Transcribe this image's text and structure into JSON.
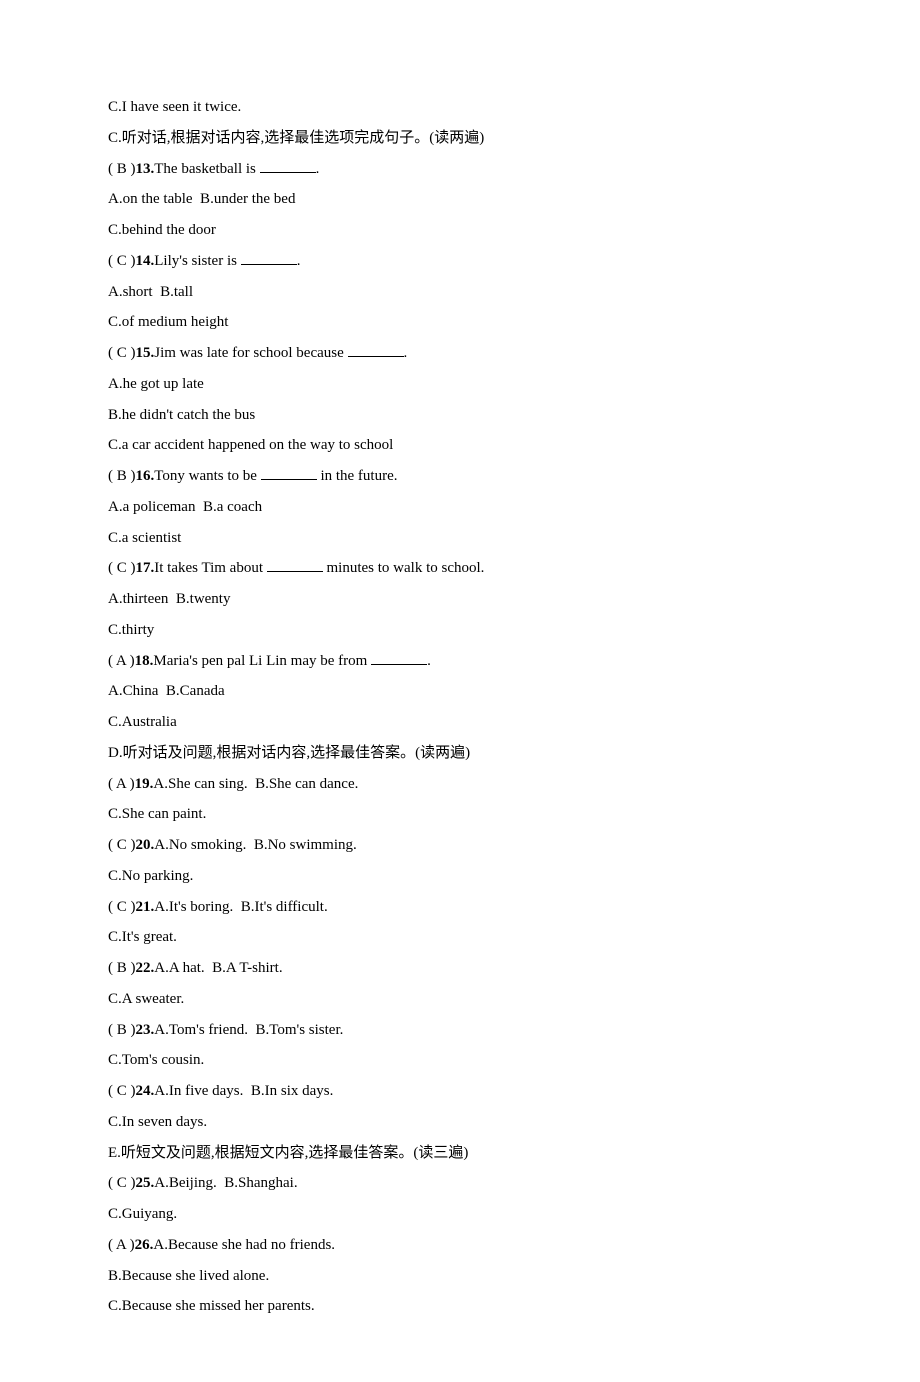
{
  "lines": [
    {
      "id": "l12c",
      "segments": [
        {
          "t": "C.I have seen it twice."
        }
      ]
    },
    {
      "id": "sectionC",
      "segments": [
        {
          "t": "C.听对话,根据对话内容,选择最佳选项完成句子。(读两遍)"
        }
      ]
    },
    {
      "id": "q13",
      "segments": [
        {
          "t": "( B )"
        },
        {
          "t": "13.",
          "bold": true
        },
        {
          "t": "The basketball is "
        },
        {
          "blank": true
        },
        {
          "t": "."
        }
      ]
    },
    {
      "id": "q13a",
      "segments": [
        {
          "t": "A.on the table  B.under the bed"
        }
      ]
    },
    {
      "id": "q13c",
      "segments": [
        {
          "t": "C.behind the door"
        }
      ]
    },
    {
      "id": "q14",
      "segments": [
        {
          "t": "( C )"
        },
        {
          "t": "14.",
          "bold": true
        },
        {
          "t": "Lily's sister is "
        },
        {
          "blank": true
        },
        {
          "t": "."
        }
      ]
    },
    {
      "id": "q14a",
      "segments": [
        {
          "t": "A.short  B.tall"
        }
      ]
    },
    {
      "id": "q14c",
      "segments": [
        {
          "t": "C.of medium height"
        }
      ]
    },
    {
      "id": "q15",
      "segments": [
        {
          "t": "( C )"
        },
        {
          "t": "15.",
          "bold": true
        },
        {
          "t": "Jim was late for school because "
        },
        {
          "blank": true
        },
        {
          "t": "."
        }
      ]
    },
    {
      "id": "q15a",
      "segments": [
        {
          "t": "A.he got up late"
        }
      ]
    },
    {
      "id": "q15b",
      "segments": [
        {
          "t": "B.he didn't catch the bus"
        }
      ]
    },
    {
      "id": "q15c",
      "segments": [
        {
          "t": "C.a car accident happened on the way to school"
        }
      ]
    },
    {
      "id": "q16",
      "segments": [
        {
          "t": "( B )"
        },
        {
          "t": "16.",
          "bold": true
        },
        {
          "t": "Tony wants to be "
        },
        {
          "blank": true
        },
        {
          "t": " in the future."
        }
      ]
    },
    {
      "id": "q16a",
      "segments": [
        {
          "t": "A.a policeman  B.a coach"
        }
      ]
    },
    {
      "id": "q16c",
      "segments": [
        {
          "t": "C.a scientist"
        }
      ]
    },
    {
      "id": "q17",
      "segments": [
        {
          "t": "( C )"
        },
        {
          "t": "17.",
          "bold": true
        },
        {
          "t": "It takes Tim about "
        },
        {
          "blank": true
        },
        {
          "t": " minutes to walk to school."
        }
      ]
    },
    {
      "id": "q17a",
      "segments": [
        {
          "t": "A.thirteen  B.twenty"
        }
      ]
    },
    {
      "id": "q17c",
      "segments": [
        {
          "t": "C.thirty"
        }
      ]
    },
    {
      "id": "q18",
      "segments": [
        {
          "t": "( A )"
        },
        {
          "t": "18.",
          "bold": true
        },
        {
          "t": "Maria's pen pal Li Lin may be from "
        },
        {
          "blank": true
        },
        {
          "t": "."
        }
      ]
    },
    {
      "id": "q18a",
      "segments": [
        {
          "t": "A.China  B.Canada"
        }
      ]
    },
    {
      "id": "q18c",
      "segments": [
        {
          "t": "C.Australia"
        }
      ]
    },
    {
      "id": "sectionD",
      "segments": [
        {
          "t": "D.听对话及问题,根据对话内容,选择最佳答案。(读两遍)"
        }
      ]
    },
    {
      "id": "q19",
      "segments": [
        {
          "t": "( A )"
        },
        {
          "t": "19.",
          "bold": true
        },
        {
          "t": "A.She can sing.  B.She can dance."
        }
      ]
    },
    {
      "id": "q19c",
      "segments": [
        {
          "t": "C.She can paint."
        }
      ]
    },
    {
      "id": "q20",
      "segments": [
        {
          "t": "( C )"
        },
        {
          "t": "20.",
          "bold": true
        },
        {
          "t": "A.No smoking.  B.No swimming."
        }
      ]
    },
    {
      "id": "q20c",
      "segments": [
        {
          "t": "C.No parking."
        }
      ]
    },
    {
      "id": "q21",
      "segments": [
        {
          "t": "( C )"
        },
        {
          "t": "21.",
          "bold": true
        },
        {
          "t": "A.It's boring.  B.It's difficult."
        }
      ]
    },
    {
      "id": "q21c",
      "segments": [
        {
          "t": "C.It's great."
        }
      ]
    },
    {
      "id": "q22",
      "segments": [
        {
          "t": "( B )"
        },
        {
          "t": "22.",
          "bold": true
        },
        {
          "t": "A.A hat.  B.A T-shirt."
        }
      ]
    },
    {
      "id": "q22c",
      "segments": [
        {
          "t": "C.A sweater."
        }
      ]
    },
    {
      "id": "q23",
      "segments": [
        {
          "t": "( B )"
        },
        {
          "t": "23.",
          "bold": true
        },
        {
          "t": "A.Tom's friend.  B.Tom's sister."
        }
      ]
    },
    {
      "id": "q23c",
      "segments": [
        {
          "t": "C.Tom's cousin."
        }
      ]
    },
    {
      "id": "q24",
      "segments": [
        {
          "t": "( C )"
        },
        {
          "t": "24.",
          "bold": true
        },
        {
          "t": "A.In five days.  B.In six days."
        }
      ]
    },
    {
      "id": "q24c",
      "segments": [
        {
          "t": "C.In seven days."
        }
      ]
    },
    {
      "id": "sectionE",
      "segments": [
        {
          "t": "E.听短文及问题,根据短文内容,选择最佳答案。(读三遍)"
        }
      ]
    },
    {
      "id": "q25",
      "segments": [
        {
          "t": "( C )"
        },
        {
          "t": "25.",
          "bold": true
        },
        {
          "t": "A.Beijing.  B.Shanghai."
        }
      ]
    },
    {
      "id": "q25c",
      "segments": [
        {
          "t": "C.Guiyang."
        }
      ]
    },
    {
      "id": "q26",
      "segments": [
        {
          "t": "( A )"
        },
        {
          "t": "26.",
          "bold": true
        },
        {
          "t": "A.Because she had no friends."
        }
      ]
    },
    {
      "id": "q26b",
      "segments": [
        {
          "t": "B.Because she lived alone."
        }
      ]
    },
    {
      "id": "q26c",
      "segments": [
        {
          "t": "C.Because she missed her parents."
        }
      ]
    }
  ]
}
